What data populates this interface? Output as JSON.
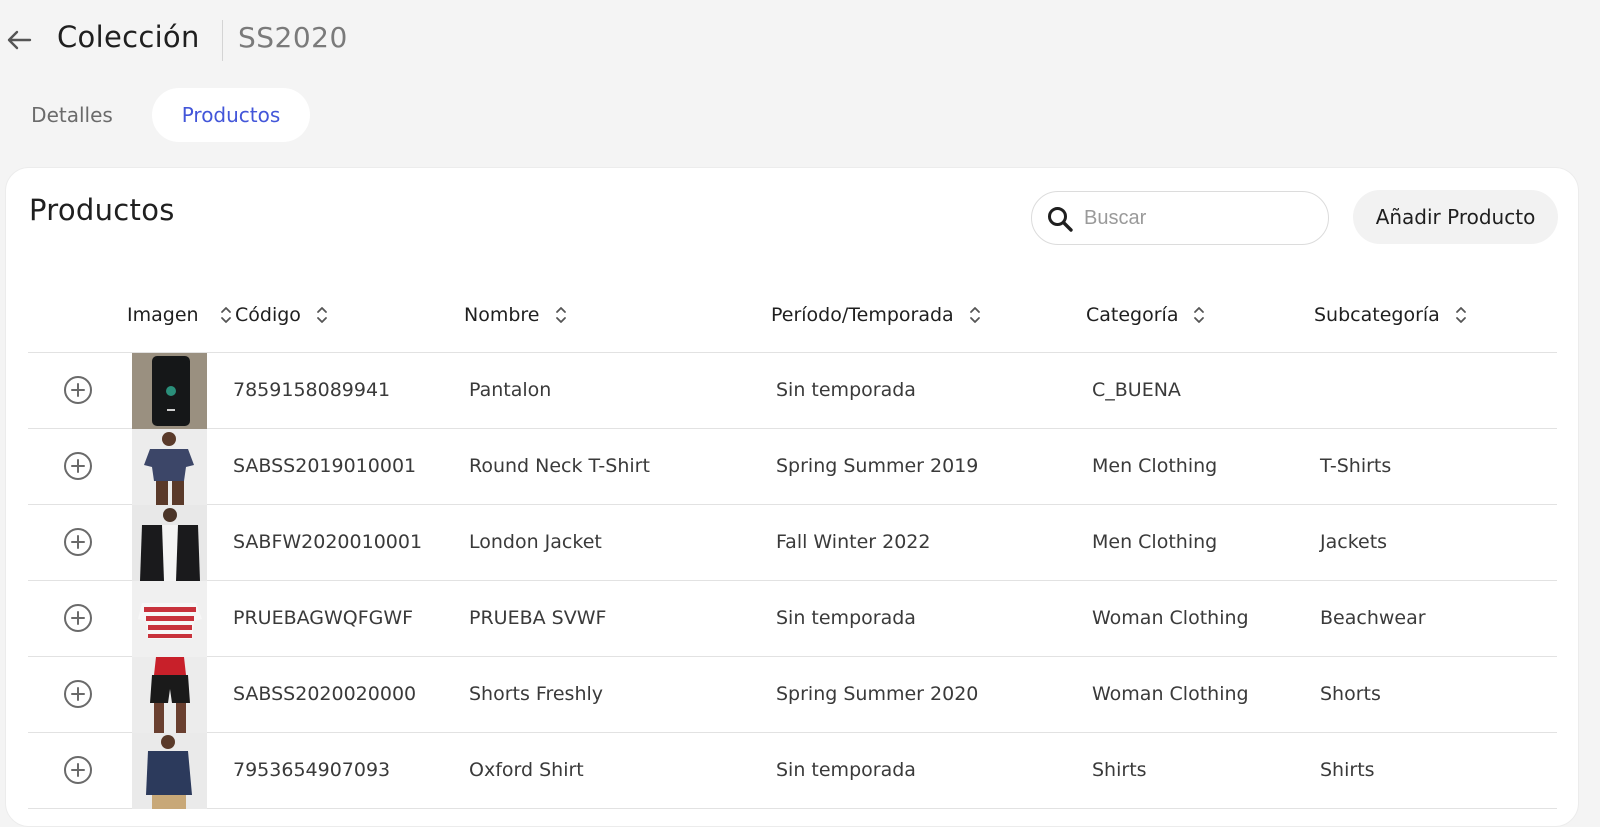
{
  "header": {
    "title": "Colección",
    "collection_code": "SS2020"
  },
  "tabs": [
    {
      "label": "Detalles",
      "active": false
    },
    {
      "label": "Productos",
      "active": true
    }
  ],
  "products_panel": {
    "title": "Productos",
    "search_placeholder": "Buscar",
    "add_button_label": "Añadir Producto"
  },
  "table": {
    "columns": [
      "Imagen",
      "Código",
      "Nombre",
      "Período/Temporada",
      "Categoría",
      "Subcategoría"
    ],
    "rows": [
      {
        "code": "7859158089941",
        "name": "Pantalon",
        "period": "Sin temporada",
        "category": "C_BUENA",
        "subcategory": "",
        "image": "dark-device"
      },
      {
        "code": "SABSS2019010001",
        "name": "Round Neck T-Shirt",
        "period": "Spring Summer 2019",
        "category": "Men Clothing",
        "subcategory": "T-Shirts",
        "image": "navy-tshirt"
      },
      {
        "code": "SABFW2020010001",
        "name": "London Jacket",
        "period": "Fall Winter 2022",
        "category": "Men Clothing",
        "subcategory": "Jackets",
        "image": "black-jacket"
      },
      {
        "code": "PRUEBAGWQFGWF",
        "name": "PRUEBA SVWF",
        "period": "Sin temporada",
        "category": "Woman Clothing",
        "subcategory": "Beachwear",
        "image": "striped-top"
      },
      {
        "code": "SABSS2020020000",
        "name": "Shorts Freshly",
        "period": "Spring Summer 2020",
        "category": "Woman Clothing",
        "subcategory": "Shorts",
        "image": "black-shorts"
      },
      {
        "code": "7953654907093",
        "name": "Oxford Shirt",
        "period": "Sin temporada",
        "category": "Shirts",
        "subcategory": "Shirts",
        "image": "navy-shirt"
      }
    ]
  },
  "colors": {
    "accent": "#4356d9",
    "background": "#f4f4f4",
    "card": "#ffffff",
    "divider": "#e2e2e2"
  }
}
